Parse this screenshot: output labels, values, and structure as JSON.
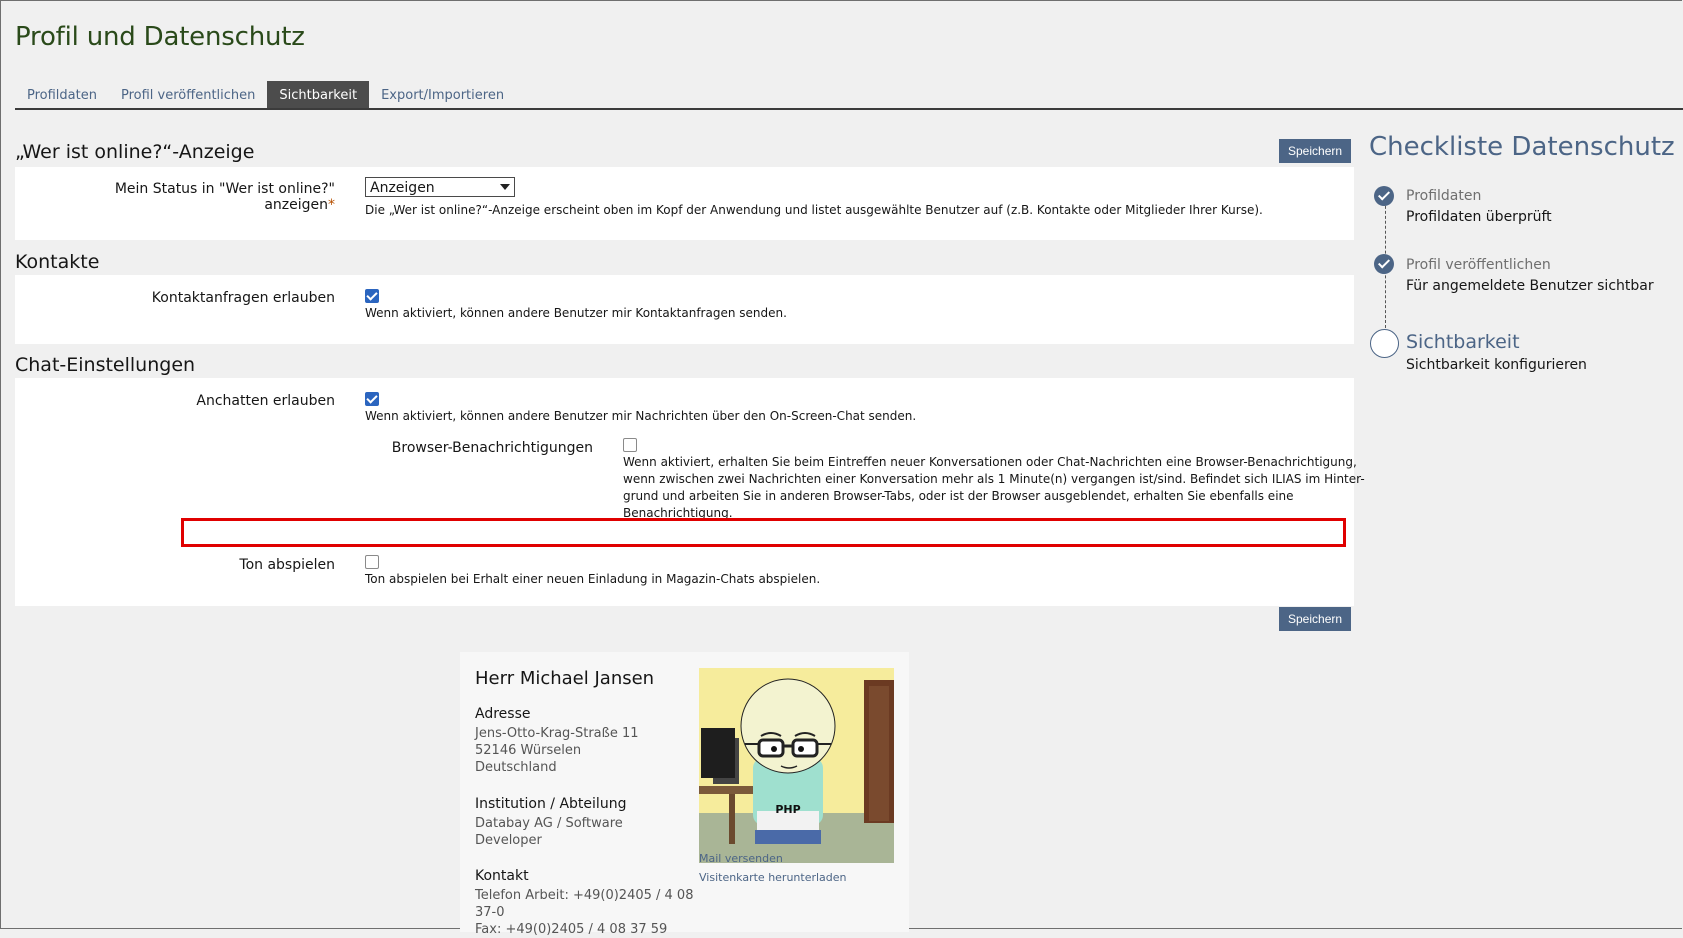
{
  "page": {
    "title": "Profil und Datenschutz"
  },
  "tabs": [
    {
      "label": "Profildaten"
    },
    {
      "label": "Profil veröffentlichen"
    },
    {
      "label": "Sichtbarkeit",
      "active": true
    },
    {
      "label": "Export/Importieren"
    }
  ],
  "save_label": "Speichern",
  "online": {
    "heading": "„Wer ist online?“-Anzeige",
    "status_label": "Mein Status in \"Wer ist online?\" anzeigen",
    "required_mark": "*",
    "select_value": "Anzeigen",
    "description": "Die „Wer ist online?“-Anzeige erscheint oben im Kopf der Anwendung und listet ausgewählte Benutzer auf (z.B. Kontakte oder Mitglieder Ihrer Kurse)."
  },
  "contacts": {
    "heading": "Kontakte",
    "allow_label": "Kontaktanfragen erlauben",
    "allow_checked": true,
    "allow_desc": "Wenn aktiviert, können andere Benutzer mir Kontaktanfragen senden."
  },
  "chat": {
    "heading": "Chat-Einstellungen",
    "anchatten_label": "Anchatten erlauben",
    "anchatten_checked": true,
    "anchatten_desc": "Wenn aktiviert, können andere Benutzer mir Nachrichten über den On-Screen-Chat senden.",
    "browser_label": "Browser-Benachrichtigungen",
    "browser_checked": false,
    "browser_desc_1": "Wenn aktiviert, erhalten Sie beim Eintreffen neuer Konversationen oder Chat-Nachrichten eine Browser-Benachrichtigung,",
    "browser_desc_2": "wenn zwischen zwei Nachrichten einer Konversation mehr als 1 Minute(n) vergangen ist/sind. Befindet sich ILIAS im Hinter-",
    "browser_desc_3": "grund und arbeiten Sie in anderen Browser-Tabs, oder ist der Browser ausgeblendet, erhalten Sie ebenfalls eine",
    "browser_desc_4": "Benachrichtigung.",
    "sound_label": "Ton abspielen",
    "sound_checked": false,
    "sound_desc": "Ton abspielen bei Erhalt einer neuen Einladung in Magazin-Chats abspielen."
  },
  "card": {
    "name": "Herr Michael Jansen",
    "address_h": "Adresse",
    "address_1": "Jens-Otto-Krag-Straße 11",
    "address_2": "52146 Würselen",
    "address_3": "Deutschland",
    "inst_h": "Institution / Abteilung",
    "inst_1": "Databay AG / Software",
    "inst_2": "Developer",
    "contact_h": "Kontakt",
    "contact_1": "Telefon Arbeit: +49(0)2405 / 4 08",
    "contact_2": "37-0",
    "contact_3": "Fax: +49(0)2405 / 4 08 37 59",
    "mail_link": "Mail versenden",
    "vcard_link": "Visitenkarte herunterladen",
    "avatar_text": "PHP"
  },
  "checklist": {
    "title": "Checkliste Datenschutz",
    "steps": [
      {
        "label": "Profildaten",
        "status": "Profildaten überprüft",
        "done": true
      },
      {
        "label": "Profil veröffentlichen",
        "status": "Für angemeldete Benutzer sichtbar",
        "done": true
      },
      {
        "label": "Sichtbarkeit",
        "status": "Sichtbarkeit konfigurieren",
        "done": false
      }
    ]
  }
}
